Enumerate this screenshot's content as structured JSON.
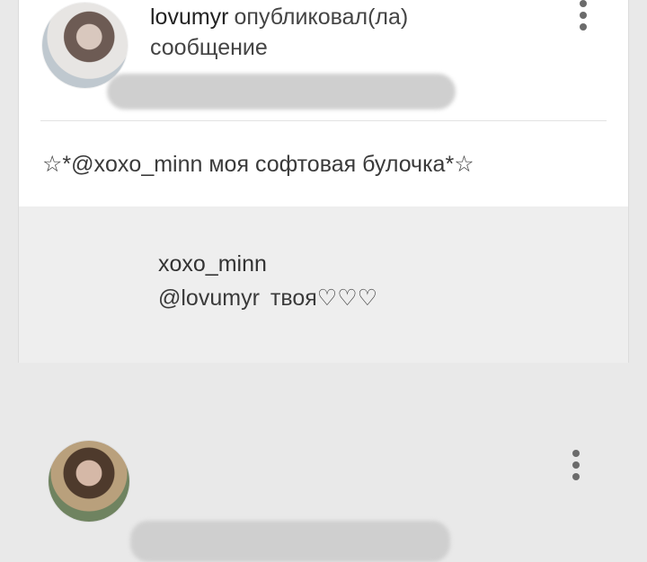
{
  "post": {
    "username": "lovumyr",
    "action": "опубликовал(ла)",
    "action_line2": "сообщение",
    "body": "☆*@xoxo_minn моя софтовая булочка*☆"
  },
  "comment": {
    "username": "xoxo_minn",
    "mention": "@lovumyr",
    "text": "твоя♡♡♡"
  },
  "icons": {
    "post_more": "more-vertical-icon",
    "comment_more": "more-vertical-icon"
  },
  "colors": {
    "card_background": "#ffffff",
    "comment_background": "#eeeeee",
    "page_background": "#e9e9e9",
    "text": "#3a3a3a"
  }
}
